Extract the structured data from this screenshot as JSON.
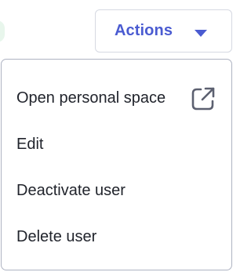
{
  "header": {
    "actions_button": {
      "label": "Actions",
      "icon": "caret-down-icon"
    }
  },
  "menu": {
    "items": [
      {
        "label": "Open personal space",
        "icon": "external-link-icon"
      },
      {
        "label": "Edit"
      },
      {
        "label": "Deactivate user"
      },
      {
        "label": "Delete user"
      }
    ]
  },
  "colors": {
    "accent": "#4a5bd1",
    "text": "#21242c",
    "border": "#aeb3c2",
    "status_dot": "#e8f6ec"
  }
}
